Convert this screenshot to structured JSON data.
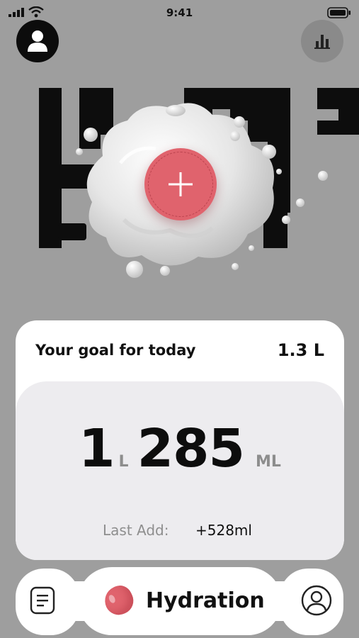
{
  "status_bar": {
    "time": "9:41",
    "icons": [
      "signal-icon",
      "wifi-icon",
      "battery-icon"
    ]
  },
  "header": {
    "left_icon": "user-icon",
    "right_icon": "bar-chart-icon"
  },
  "hero": {
    "add_icon": "plus-icon"
  },
  "goal": {
    "label": "Your goal for today",
    "value": "1.3 L"
  },
  "intake": {
    "liters": "1",
    "liters_unit": "L",
    "milliliters": "285",
    "ml_unit": "ML",
    "last_add_label": "Last Add:",
    "last_add_value": "+528ml"
  },
  "nav": {
    "left_icon": "notes-icon",
    "center_label": "Hydration",
    "center_icon": "water-drop-icon",
    "right_icon": "profile-icon"
  },
  "colors": {
    "background": "#9e9e9e",
    "accent": "#e0636d",
    "card": "#ffffff",
    "panel": "#edecef"
  }
}
